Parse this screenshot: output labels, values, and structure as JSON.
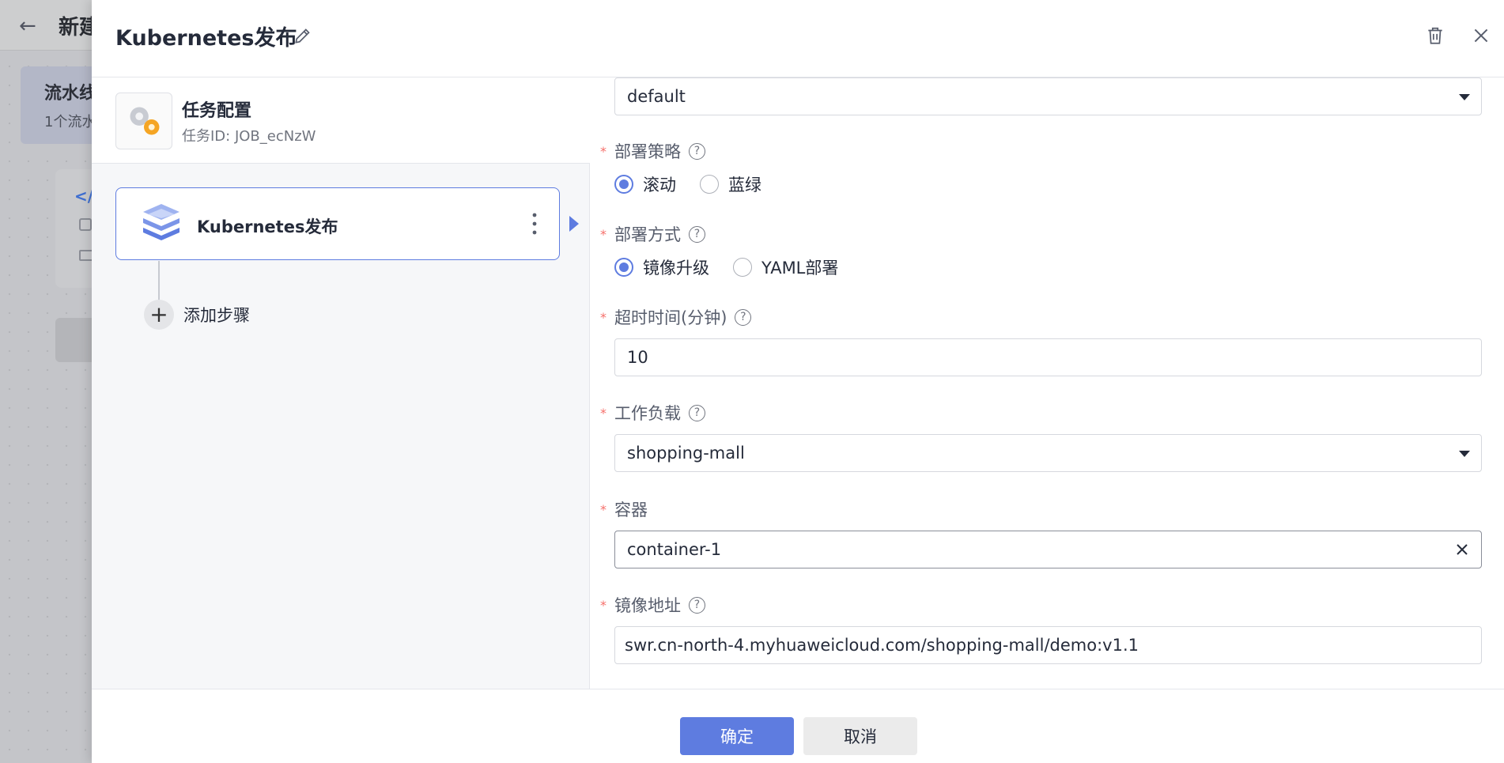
{
  "background": {
    "title": "新建",
    "card_title": "流水线",
    "card_sub": "1个流水"
  },
  "drawer": {
    "title": "Kubernetes发布"
  },
  "job": {
    "title": "任务配置",
    "id": "任务ID: JOB_ecNzW"
  },
  "step": {
    "name": "Kubernetes发布",
    "add_label": "添加步骤"
  },
  "form": {
    "namespace_value": "default",
    "strategy": {
      "label": "部署策略",
      "options": [
        "滚动",
        "蓝绿"
      ],
      "selected": "滚动"
    },
    "method": {
      "label": "部署方式",
      "options": [
        "镜像升级",
        "YAML部署"
      ],
      "selected": "镜像升级"
    },
    "timeout": {
      "label": "超时时间(分钟)",
      "value": "10"
    },
    "workload": {
      "label": "工作负载",
      "value": "shopping-mall"
    },
    "container": {
      "label": "容器",
      "value": "container-1"
    },
    "image": {
      "label": "镜像地址",
      "value": "swr.cn-north-4.myhuaweicloud.com/shopping-mall/demo:v1.1"
    },
    "required_mark": "*",
    "help_mark": "?"
  },
  "footer": {
    "confirm": "确定",
    "cancel": "取消"
  },
  "colors": {
    "accent": "#5e7ce0",
    "required": "#f66f6a"
  }
}
